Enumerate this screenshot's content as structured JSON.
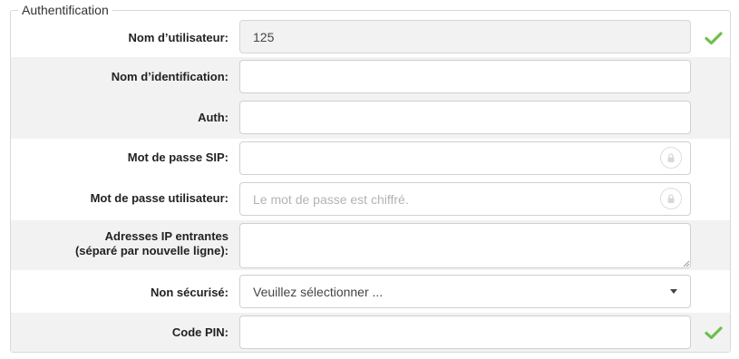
{
  "fieldset": {
    "legend": "Authentification"
  },
  "fields": {
    "username": {
      "label": "Nom d’utilisateur:",
      "value": "125",
      "status_icon": "check-icon"
    },
    "identification_name": {
      "label": "Nom d’identification:",
      "value": ""
    },
    "auth": {
      "label": "Auth:",
      "value": ""
    },
    "sip_password": {
      "label": "Mot de passe SIP:",
      "value": "",
      "icon": "lock-icon"
    },
    "user_password": {
      "label": "Mot de passe utilisateur:",
      "placeholder": "Le mot de passe est chiffré.",
      "icon": "lock-icon"
    },
    "incoming_ips": {
      "label_line1": "Adresses IP entrantes",
      "label_line2": "(séparé par nouvelle ligne):",
      "value": ""
    },
    "insecure": {
      "label": "Non sécurisé:",
      "selected": "Veuillez sélectionner ...",
      "icon": "caret-down-icon"
    },
    "pin_code": {
      "label": "Code PIN:",
      "value": "",
      "status_icon": "check-icon"
    }
  },
  "colors": {
    "check_green": "#6cc04a",
    "row_grey": "#f2f2f2",
    "border": "#d0d0d0"
  }
}
